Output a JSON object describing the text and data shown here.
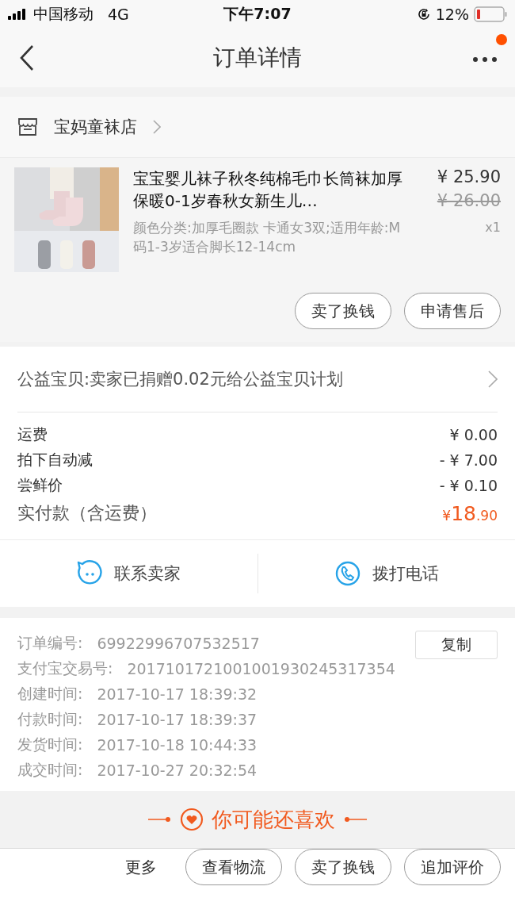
{
  "status_bar": {
    "carrier": "中国移动",
    "network": "4G",
    "time": "下午7:07",
    "battery": "12%"
  },
  "nav": {
    "title": "订单详情",
    "has_notification": true
  },
  "shop": {
    "name": "宝妈童袜店"
  },
  "product": {
    "image": {
      "kind": "picture"
    },
    "title": "宝宝婴儿袜子秋冬纯棉毛巾长筒袜加厚保暖0-1岁春秋女新生儿…",
    "spec": "颜色分类:加厚毛圈款  卡通女3双;适用年龄:M码1-3岁适合脚长12-14cm",
    "price": "¥ 25.90",
    "original_price": "¥ 26.00",
    "quantity": "x1",
    "buttons": [
      "卖了换钱",
      "申请售后"
    ]
  },
  "charity": {
    "text": "公益宝贝:卖家已捐赠0.02元给公益宝贝计划"
  },
  "fees": [
    {
      "label": "运费",
      "value": "¥ 0.00"
    },
    {
      "label": "拍下自动减",
      "value": "- ¥ 7.00"
    },
    {
      "label": "尝鲜价",
      "value": "- ¥ 0.10"
    }
  ],
  "total": {
    "label": "实付款（含运费）",
    "currency": "¥",
    "integer": "18",
    "fraction": ".90"
  },
  "contact": [
    {
      "kind": "chat",
      "label": "联系卖家"
    },
    {
      "kind": "phone",
      "label": "拨打电话"
    }
  ],
  "order_info": {
    "copy_button": "复制",
    "rows": [
      {
        "label": "订单编号:",
        "value": "69922996707532517"
      },
      {
        "label": "支付宝交易号:",
        "value": "2017101721001001930245317354"
      },
      {
        "label": "创建时间:",
        "value": "2017-10-17 18:39:32"
      },
      {
        "label": "付款时间:",
        "value": "2017-10-17 18:39:37"
      },
      {
        "label": "发货时间:",
        "value": "2017-10-18 10:44:33"
      },
      {
        "label": "成交时间:",
        "value": "2017-10-27 20:32:54"
      }
    ]
  },
  "recommend": {
    "title": "你可能还喜欢"
  },
  "bottom_bar": {
    "more": "更多",
    "buttons": [
      "查看物流",
      "卖了换钱",
      "追加评价"
    ]
  }
}
